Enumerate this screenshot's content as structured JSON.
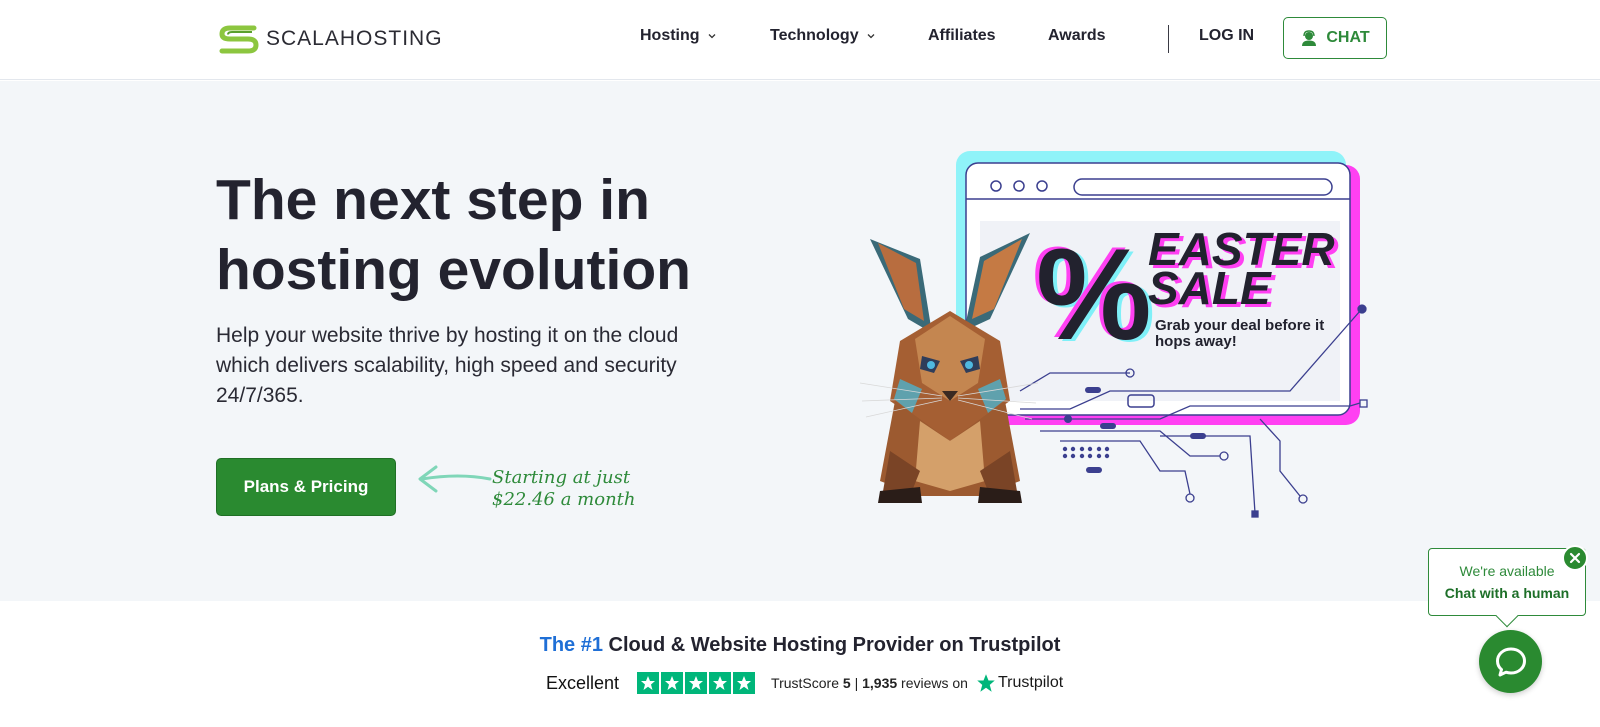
{
  "header": {
    "logo_text": "SCALAHOSTING",
    "nav": [
      {
        "label": "Hosting",
        "has_dropdown": true
      },
      {
        "label": "Technology",
        "has_dropdown": true
      },
      {
        "label": "Affiliates",
        "has_dropdown": false
      },
      {
        "label": "Awards",
        "has_dropdown": false
      }
    ],
    "login_label": "LOG IN",
    "chat_label": "CHAT"
  },
  "hero": {
    "title_line1": "The next step in",
    "title_line2": "hosting evolution",
    "subtitle": "Help your website thrive by hosting it on the cloud which delivers scalability, high speed and security 24/7/365.",
    "cta_label": "Plans & Pricing",
    "note_line1": "Starting at just",
    "note_line2": "$22.46 a month"
  },
  "promo": {
    "headline_1": "EASTER",
    "headline_2": "SALE",
    "tagline_1": "Grab your deal before it",
    "tagline_2": "hops away!",
    "percent_symbol": "%"
  },
  "trust": {
    "prefix": "The #1",
    "title_rest": " Cloud & Website Hosting Provider on Trustpilot",
    "rating_word": "Excellent",
    "stars": 5,
    "trustscore_label": "TrustScore",
    "trustscore_value": "5",
    "reviews_text": "1,935",
    "reviews_suffix": "reviews on",
    "trustpilot_name": "Trustpilot"
  },
  "chat_widget": {
    "line1": "We're available",
    "line2": "Chat with a human"
  },
  "colors": {
    "brand_green": "#2a8a30",
    "trust_green": "#00b67a",
    "highlight_blue": "#1f6fd6",
    "promo_cyan": "#7ff0f8",
    "promo_magenta": "#ff3df5"
  }
}
